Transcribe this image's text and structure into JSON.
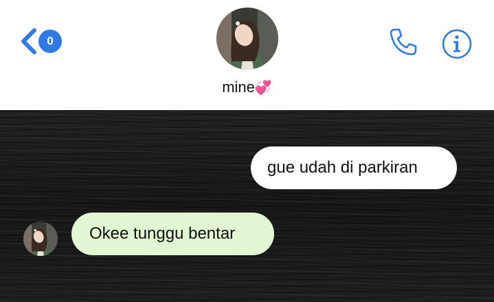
{
  "header": {
    "back_badge_count": "0",
    "contact_name": "mine",
    "contact_emoji": "💞",
    "icons": [
      "back-chevron-icon",
      "phone-icon",
      "info-icon"
    ],
    "accent_color": "#2f7ae5"
  },
  "messages": [
    {
      "direction": "sent",
      "text": "gue udah di parkiran",
      "bubble_color": "#ffffff"
    },
    {
      "direction": "received",
      "text": "Okee tunggu bentar",
      "bubble_color": "#e3f6d3"
    }
  ]
}
